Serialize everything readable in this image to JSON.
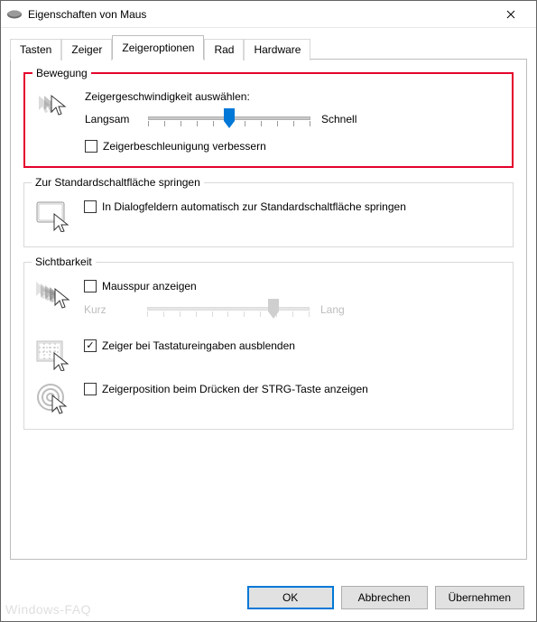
{
  "window": {
    "title": "Eigenschaften von Maus"
  },
  "tabs": {
    "tasten": "Tasten",
    "zeiger": "Zeiger",
    "zeigeroptionen": "Zeigeroptionen",
    "rad": "Rad",
    "hardware": "Hardware"
  },
  "motion": {
    "group_title": "Bewegung",
    "speed_label": "Zeigergeschwindigkeit auswählen:",
    "slow": "Langsam",
    "fast": "Schnell",
    "enhance_precision": "Zeigerbeschleunigung verbessern",
    "enhance_precision_checked": false,
    "speed_value_percent": 50
  },
  "snap": {
    "group_title": "Zur Standardschaltfläche springen",
    "snap_to_default": "In Dialogfeldern automatisch zur Standardschaltfläche springen",
    "snap_to_default_checked": false
  },
  "visibility": {
    "group_title": "Sichtbarkeit",
    "trails_label": "Mausspur anzeigen",
    "trails_checked": false,
    "trails_short": "Kurz",
    "trails_long": "Lang",
    "trails_value_percent": 78,
    "hide_while_typing": "Zeiger bei Tastatureingaben ausblenden",
    "hide_while_typing_checked": true,
    "show_on_ctrl": "Zeigerposition beim Drücken der STRG-Taste anzeigen",
    "show_on_ctrl_checked": false
  },
  "buttons": {
    "ok": "OK",
    "cancel": "Abbrechen",
    "apply": "Übernehmen"
  },
  "watermark": "Windows-FAQ"
}
